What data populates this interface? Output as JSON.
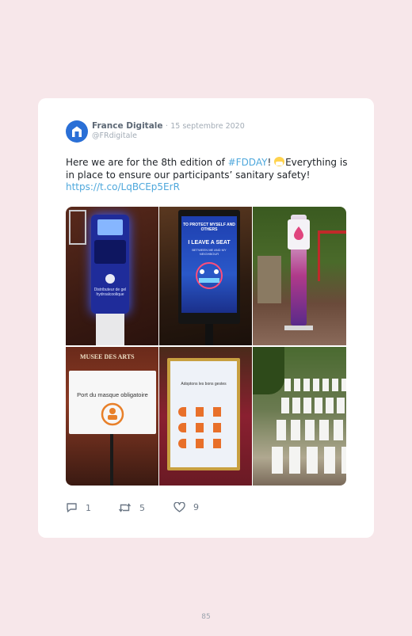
{
  "tweet": {
    "author_name": "France Digitale",
    "separator": "·",
    "date": "15 septembre 2020",
    "handle": "@FRdigitale",
    "text_part1": "Here we are for the 8th edition of ",
    "hashtag": "#FDDAY",
    "text_part2": "! ",
    "text_part3": "Everything is in place to ensure our participants’ sanitary safety! ",
    "link": "https://t.co/LqBCEp5ErR",
    "emoji_icon": "face-with-medical-mask-icon"
  },
  "photos": [
    {
      "name": "photo-sanitizer-kiosk-blue",
      "sign_text": "Distributeur de gel hydroalcoolique"
    },
    {
      "name": "photo-digital-sign-leave-a-seat",
      "heading": "TO PROTECT MYSELF AND OTHERS",
      "main": "I LEAVE A SEAT",
      "sub": "BETWEEN ME AND MY NEIGHBOUR"
    },
    {
      "name": "photo-sanitizer-stand-pink",
      "sign_text": ""
    },
    {
      "name": "photo-mask-mandatory-sign",
      "top_text": "MUSEE DES ARTS",
      "sign_text": "Port du masque obligatoire"
    },
    {
      "name": "photo-safety-rules-poster",
      "sign_text": "Adoptons les bons gestes"
    },
    {
      "name": "photo-white-chairs-garden",
      "sign_text": ""
    }
  ],
  "stats": {
    "replies": "1",
    "retweets": "5",
    "likes": "9"
  },
  "colors": {
    "page_background": "#f7e7ea",
    "card": "#ffffff",
    "link": "#4fa8dc",
    "avatar": "#2a6fd6"
  },
  "page_number": "85"
}
